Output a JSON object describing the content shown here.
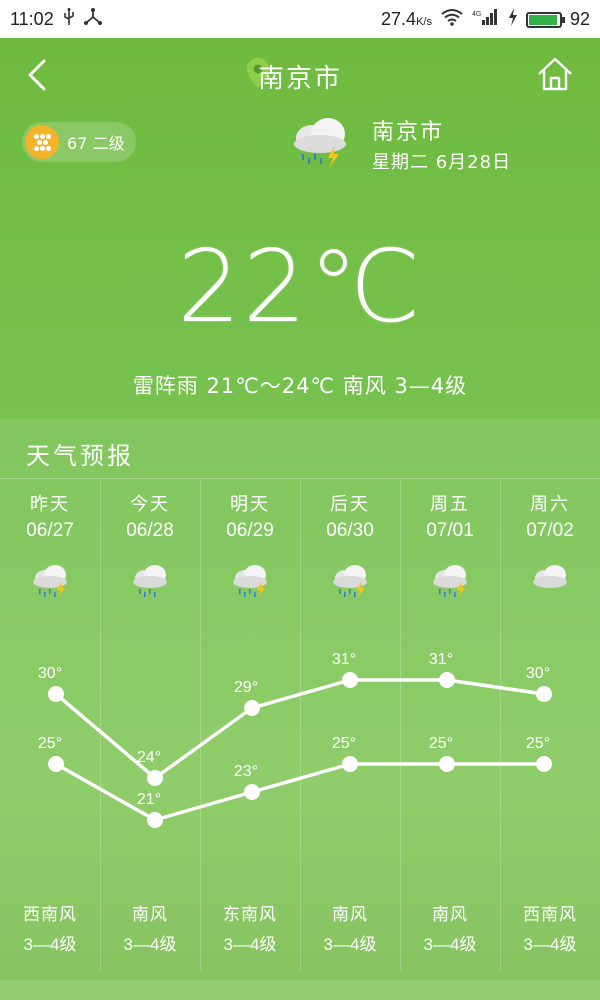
{
  "status_bar": {
    "time": "11:02",
    "net_speed": "27.4",
    "net_speed_unit": "K/s",
    "network_type": "4G",
    "battery_level": "92",
    "battery_fraction": 0.92
  },
  "header": {
    "city": "南京市"
  },
  "aqi": {
    "value": "67",
    "level": "二级"
  },
  "current": {
    "city": "南京市",
    "date": "星期二 6月28日",
    "temp": "22℃",
    "summary": "雷阵雨 21℃～24℃ 南风 3—4级"
  },
  "forecast": {
    "title": "天气预报",
    "days": [
      {
        "name": "昨天",
        "date": "06/27",
        "high": 30,
        "low": 25,
        "high_label": "30°",
        "low_label": "25°",
        "wind_dir": "西南风",
        "wind_lvl": "3—4级",
        "icon": "thunder-rain-icon"
      },
      {
        "name": "今天",
        "date": "06/28",
        "high": 24,
        "low": 21,
        "high_label": "24°",
        "low_label": "21°",
        "wind_dir": "南风",
        "wind_lvl": "3—4级",
        "icon": "rain-icon"
      },
      {
        "name": "明天",
        "date": "06/29",
        "high": 29,
        "low": 23,
        "high_label": "29°",
        "low_label": "23°",
        "wind_dir": "东南风",
        "wind_lvl": "3—4级",
        "icon": "thunder-rain-icon"
      },
      {
        "name": "后天",
        "date": "06/30",
        "high": 31,
        "low": 25,
        "high_label": "31°",
        "low_label": "25°",
        "wind_dir": "南风",
        "wind_lvl": "3—4级",
        "icon": "thunder-rain-icon"
      },
      {
        "name": "周五",
        "date": "07/01",
        "high": 31,
        "low": 25,
        "high_label": "31°",
        "low_label": "25°",
        "wind_dir": "南风",
        "wind_lvl": "3—4级",
        "icon": "thunder-rain-icon"
      },
      {
        "name": "周六",
        "date": "07/02",
        "high": 30,
        "low": 25,
        "high_label": "30°",
        "low_label": "25°",
        "wind_dir": "西南风",
        "wind_lvl": "3—4级",
        "icon": "cloudy-icon"
      }
    ]
  },
  "colors": {
    "accent_green": "#6dba3d",
    "aqi_yellow": "#f4b42a",
    "battery_green": "#34b24a"
  }
}
